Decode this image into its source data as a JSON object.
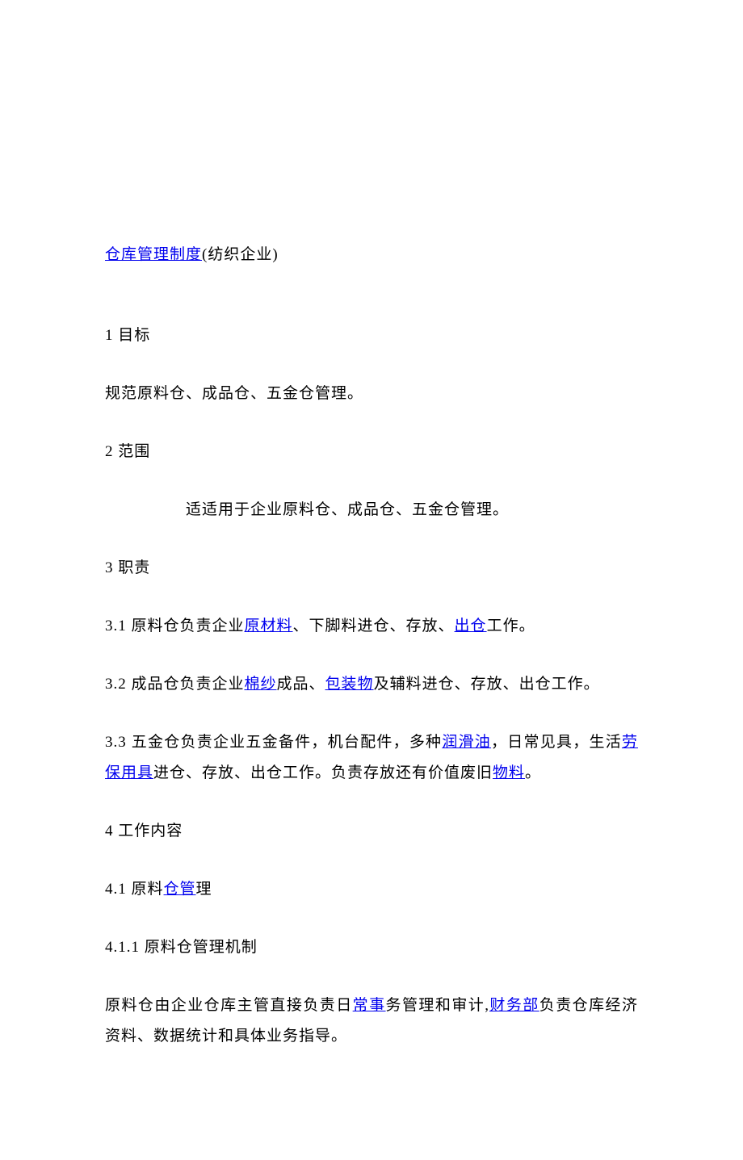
{
  "title": {
    "link": "仓库管理制度",
    "suffix": "(纺织企业)"
  },
  "p1": "1 目标",
  "p2": "规范原料仓、成品仓、五金仓管理。",
  "p3": "2 范围",
  "p4": "适适用于企业原料仓、成品仓、五金仓管理。",
  "p5": "3 职责",
  "p6": {
    "t1": "3.1 原料仓负责企业",
    "l1": "原材料",
    "t2": "、下脚料进仓、存放、",
    "l2": "出仓",
    "t3": "工作。"
  },
  "p7": {
    "t1": "3.2 成品仓负责企业",
    "l1": "棉纱",
    "t2": "成品、",
    "l2": "包装物",
    "t3": "及辅料进仓、存放、出仓工作。"
  },
  "p8": {
    "t1": "3.3 五金仓负责企业五金备件，机台配件，多种",
    "l1": "润滑油",
    "t2": "，日常见具，生活",
    "l2": "劳保用具",
    "t3": "进仓、存放、出仓工作。负责存放还有价值废旧",
    "l3": "物料",
    "t4": "。"
  },
  "p9": "4 工作内容",
  "p10": {
    "t1": "4.1 原料",
    "l1": "仓管",
    "t2": "理"
  },
  "p11": "4.1.1 原料仓管理机制",
  "p12": {
    "t1": "原料仓由企业仓库主管直接负责日",
    "l1": "常事",
    "t2": "务管理和审计,",
    "l2": "财务部",
    "t3": "负责仓库经济资料、数据统计和具体业务指导。"
  }
}
